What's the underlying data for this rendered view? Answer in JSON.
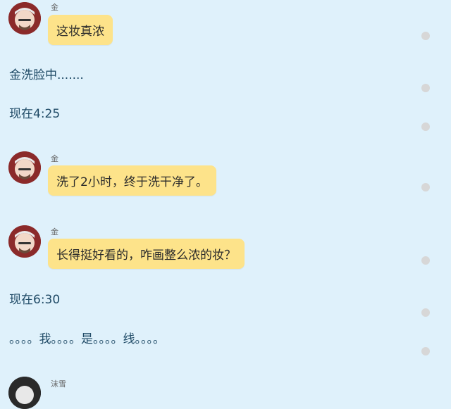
{
  "messages": [
    {
      "type": "chat",
      "sender": "金",
      "text": "这妆真浓"
    },
    {
      "type": "text",
      "text": "金洗脸中......."
    },
    {
      "type": "text",
      "text": "现在4:25"
    },
    {
      "type": "chat",
      "sender": "金",
      "text": "洗了2小时，终于洗干净了。"
    },
    {
      "type": "chat",
      "sender": "金",
      "text": "长得挺好看的，咋画整么浓的妆？"
    },
    {
      "type": "text",
      "text": "现在6:30"
    },
    {
      "type": "text",
      "text": "。。。。我。。。。是。。。。线。。。。"
    },
    {
      "type": "chat",
      "sender": "沫雪",
      "text": ""
    }
  ],
  "icons": {
    "avatar": "avatar-icon",
    "status_dot": "status-dot-icon"
  },
  "colors": {
    "background": "#dff1fb",
    "bubble": "#fde38a",
    "plain_text": "#1f4a66",
    "dot": "#d7d7d7"
  }
}
